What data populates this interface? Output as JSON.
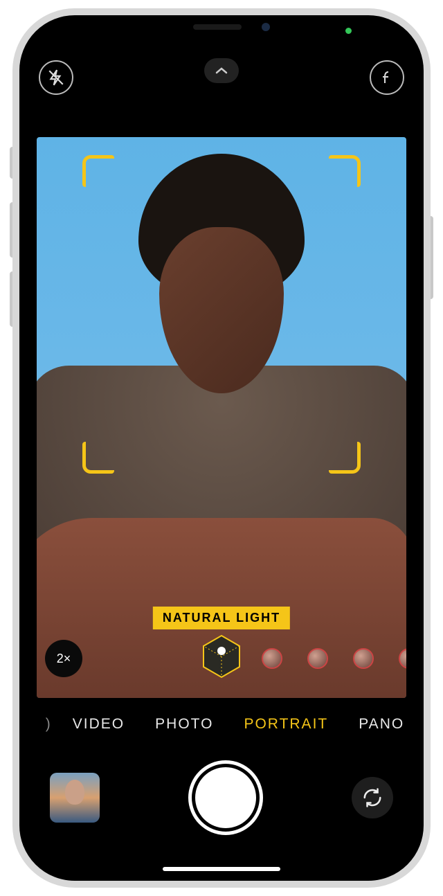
{
  "lighting": {
    "current_label": "NATURAL LIGHT"
  },
  "zoom": {
    "label": "2×"
  },
  "modes": {
    "items": [
      "VIDEO",
      "PHOTO",
      "PORTRAIT",
      "PANO"
    ],
    "selected_index": 2,
    "clipped_left": ")"
  },
  "icons": {
    "flash": "flash-off",
    "expand": "chevron-up",
    "depth": "f-stop",
    "light_cube": "lighting-cube",
    "flip": "camera-flip"
  },
  "status": {
    "privacy_dot_color": "#34c759"
  }
}
